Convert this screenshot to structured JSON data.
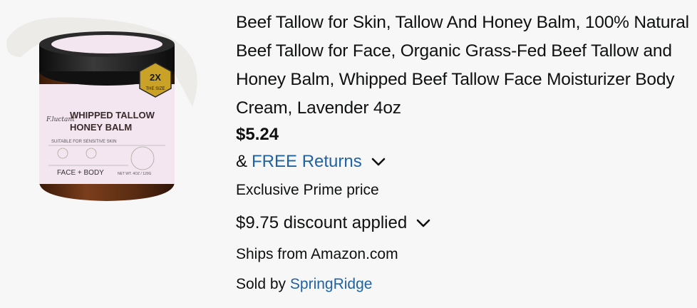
{
  "product": {
    "title": "Beef Tallow for Skin, Tallow And Honey Balm, 100% Natural Beef Tallow for Face, Organic Grass-Fed Beef Tallow and Honey Balm, Whipped Beef Tallow Face Moisturizer Body Cream, Lavender 4oz",
    "price": "$5.24",
    "returns_prefix": "&",
    "returns_link": "FREE Returns",
    "prime_text": "Exclusive Prime price",
    "discount_text": "$9.75 discount applied",
    "ships_text": "Ships from Amazon.com",
    "sold_prefix": "Sold by",
    "seller": "SpringRidge"
  },
  "jar_label": {
    "script": "F.luctant",
    "line1": "WHIPPED TALLOW",
    "line2": "HONEY BALM",
    "sub": "SUITABLE FOR SENSITIVE SKIN",
    "bottom_left": "FACE + BODY",
    "bottom_right": "NET WT. 4OZ / 120G",
    "badge_top": "2X",
    "badge_bottom": "THE SIZE"
  },
  "colors": {
    "link": "#2162a1",
    "text": "#0f1111",
    "jar_brown": "#5a2e16",
    "label_pink": "#f3e6f0",
    "lid": "#1b1b1b",
    "badge_gold": "#c9a227"
  }
}
